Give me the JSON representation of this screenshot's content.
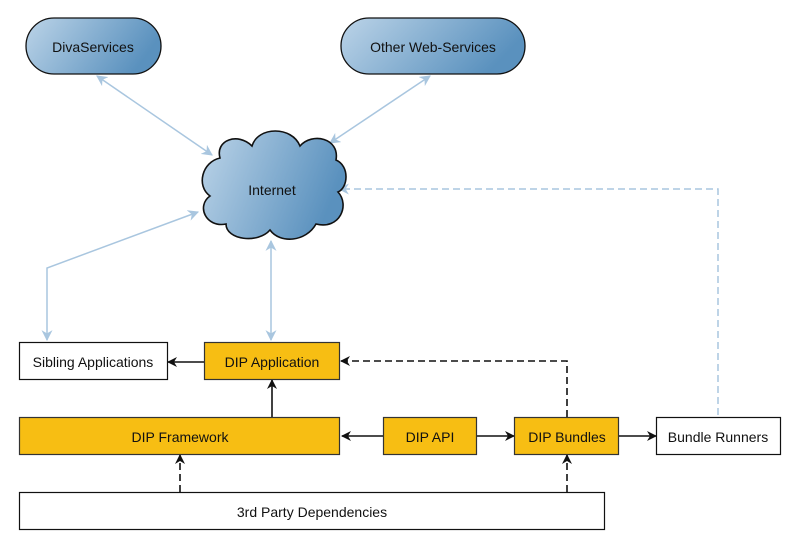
{
  "diagram": {
    "colors": {
      "component_fill": "#f7be13",
      "external_fill": "#ffffff",
      "cloud_light": "#b9d3e6",
      "cloud_dark": "#5e94c0",
      "network_edge": "#a9c6df",
      "dependency_edge": "#111111"
    },
    "nodes": {
      "divaservices": "DivaServices",
      "other_web_services": "Other Web-Services",
      "internet": "Internet",
      "sibling_applications": "Sibling Applications",
      "dip_application": "DIP Application",
      "dip_framework": "DIP Framework",
      "dip_api": "DIP API",
      "dip_bundles": "DIP Bundles",
      "bundle_runners": "Bundle Runners",
      "third_party": "3rd Party Dependencies"
    },
    "edges": [
      {
        "from": "internet",
        "to": "divaservices",
        "style": "solid",
        "bidirectional": true,
        "color": "network"
      },
      {
        "from": "internet",
        "to": "other_web_services",
        "style": "solid",
        "bidirectional": true,
        "color": "network"
      },
      {
        "from": "internet",
        "to": "sibling_applications",
        "style": "solid",
        "bidirectional": true,
        "color": "network"
      },
      {
        "from": "internet",
        "to": "dip_application",
        "style": "solid",
        "bidirectional": true,
        "color": "network"
      },
      {
        "from": "bundle_runners",
        "to": "internet",
        "style": "dashed",
        "bidirectional": false,
        "color": "network"
      },
      {
        "from": "dip_application",
        "to": "sibling_applications",
        "style": "solid",
        "bidirectional": false,
        "color": "dependency"
      },
      {
        "from": "dip_framework",
        "to": "dip_application",
        "style": "solid",
        "bidirectional": false,
        "color": "dependency"
      },
      {
        "from": "dip_api",
        "to": "dip_framework",
        "style": "solid",
        "bidirectional": false,
        "color": "dependency"
      },
      {
        "from": "dip_api",
        "to": "dip_bundles",
        "style": "solid",
        "bidirectional": false,
        "color": "dependency"
      },
      {
        "from": "dip_bundles",
        "to": "bundle_runners",
        "style": "solid",
        "bidirectional": false,
        "color": "dependency"
      },
      {
        "from": "dip_bundles",
        "to": "dip_application",
        "style": "dashed",
        "bidirectional": false,
        "color": "dependency"
      },
      {
        "from": "third_party",
        "to": "dip_framework",
        "style": "dashed",
        "bidirectional": false,
        "color": "dependency"
      },
      {
        "from": "third_party",
        "to": "dip_bundles",
        "style": "dashed",
        "bidirectional": false,
        "color": "dependency"
      }
    ]
  }
}
